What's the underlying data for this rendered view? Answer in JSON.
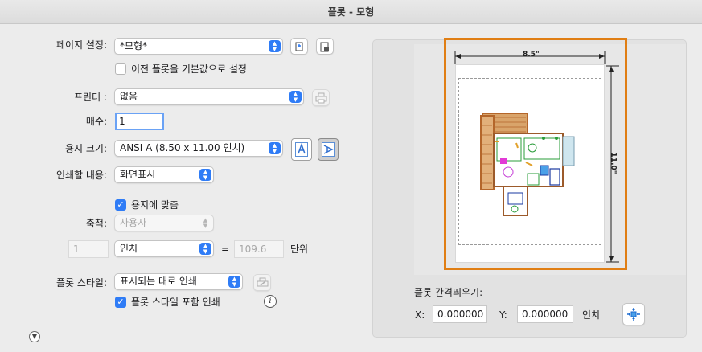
{
  "window": {
    "title": "플롯 - 모형"
  },
  "page_setup": {
    "label": "페이지 설정:",
    "value": "*모형*"
  },
  "use_as_default": {
    "label": "이전 플롯을 기본값으로 설정",
    "checked": false
  },
  "printer": {
    "label": "프린터 :",
    "value": "없음"
  },
  "copies": {
    "label": "매수:",
    "value": "1"
  },
  "paper_size": {
    "label": "용지 크기:",
    "value": "ANSI A (8.50 x 11.00 인치)"
  },
  "plot_area": {
    "label": "인쇄할 내용:",
    "value": "화면표시"
  },
  "fit_to_paper": {
    "label": "용지에 맞춤",
    "checked": true
  },
  "scale": {
    "label": "축척:",
    "value": "사용자",
    "left_value": "1",
    "unit": "인치",
    "equals": "=",
    "right_value": "109.6",
    "right_unit": "단위"
  },
  "plot_style": {
    "label": "플롯 스타일:",
    "value": "표시되는 대로 인쇄"
  },
  "plot_with_styles": {
    "label": "플롯 스타일 포함 인쇄",
    "checked": true
  },
  "preview": {
    "width_label": "8.5\"",
    "height_label": "11.0\""
  },
  "plot_offset": {
    "label": "플롯 간격띄우기:",
    "x_label": "X:",
    "x_value": "0.000000",
    "y_label": "Y:",
    "y_value": "0.000000",
    "unit": "인치"
  },
  "colors": {
    "accent": "#2f7cf6",
    "highlight": "#e07e14"
  }
}
